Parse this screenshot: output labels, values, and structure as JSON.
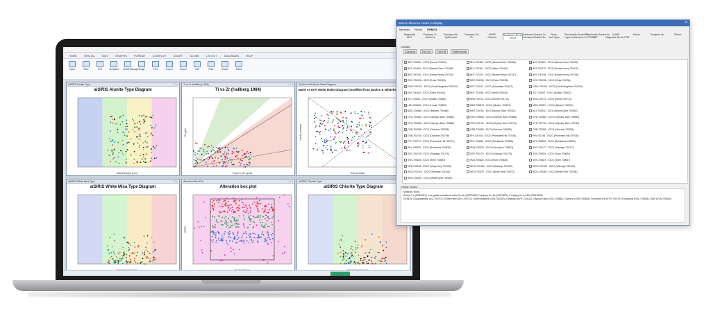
{
  "app": {
    "menu": [
      "HOME",
      "SPATIAL",
      "EDIT",
      "GRAPHS",
      "FORMAT",
      "COMPUTE",
      "CHART",
      "GLOBE",
      "LAYOUT",
      "DIAGRAMS",
      "HELP"
    ],
    "active_menu_index": 8,
    "ribbon_buttons": [
      {
        "label": "Open",
        "icon": "folder-icon"
      },
      {
        "label": "Save",
        "icon": "save-icon"
      },
      {
        "label": "Plot",
        "icon": "plot-icon"
      },
      {
        "label": "Templates",
        "icon": "template-icon"
      },
      {
        "label": "ioGAS Manager",
        "icon": "manager-icon"
      },
      {
        "label": "Image",
        "icon": "image-icon"
      },
      {
        "label": "Print",
        "icon": "print-icon"
      },
      {
        "label": "Export",
        "icon": "export-icon"
      },
      {
        "label": "Report",
        "icon": "report-icon"
      },
      {
        "label": "Edit",
        "icon": "edit-icon"
      },
      {
        "label": "Filter",
        "icon": "filter-icon"
      },
      {
        "label": "Search",
        "icon": "search-icon"
      },
      {
        "label": "Select",
        "icon": "select-icon"
      }
    ],
    "panes": [
      {
        "window_title": "aiSIRIS Alunite Type",
        "chart_title": "aiSIRIS Alunite Type Diagram",
        "xlabel": "Wavelength (nm)",
        "ylabel": ""
      },
      {
        "window_title": "Ti vs Zr (Hallberg 1984)",
        "chart_title": "Ti vs Zr (Hallberg 1984)",
        "xlabel": "Ti ppm (Zr ppm)",
        "ylabel": "Zr ppm"
      },
      {
        "window_title": "Na/Al vs K/Al Molar Ratio Diagram",
        "chart_title": "Na/Al vs K/Al Molar Ratio Diagram (modified from Davies & Whitehead 2006)",
        "xlabel": "K/Al (molar)",
        "ylabel": "Na/Al (molar)"
      },
      {
        "window_title": "aiSIRIS White Mica Type",
        "chart_title": "aiSIRIS White Mica Type Diagram",
        "xlabel": "Wavelength (nm)",
        "ylabel": ""
      },
      {
        "window_title": "Alteration Box Plot",
        "chart_title": "Alteration box plot",
        "xlabel": "AI (Ishikawa)",
        "ylabel": "CCPI"
      },
      {
        "window_title": "aiSIRIS Chlorite Type",
        "chart_title": "aiSIRIS Chlorite Type Diagram",
        "xlabel": "Wavelength (nm)",
        "ylabel": ""
      }
    ]
  },
  "dialog": {
    "title": "Select reference nodes to display",
    "close_glyph": "×",
    "tabs": [
      "Minerals",
      "Rocks",
      "DEMO3"
    ],
    "selected_tab_index": 2,
    "subtabs": [
      {
        "top": "Magnetite",
        "bottom": "BHT"
      },
      {
        "top": "Porphyry Cu",
        "bottom": "Carlin Au"
      },
      {
        "top": "Porphyry Mo",
        "bottom": "Epithermal"
      },
      {
        "top": "Porphyry Sn",
        "bottom": "Fe"
      },
      {
        "top": "SHMS",
        "bottom": "Greisen"
      },
      {
        "top": "Sandstone Pb-Zn",
        "bottom": "IOCG"
      },
      {
        "top": "Sediment Hosted Cu",
        "bottom": "Intrusion Related Au"
      },
      {
        "top": "Skarn",
        "bottom": "Irish Type"
      },
      {
        "top": "Structurally Hosted Cu",
        "bottom": "Layered Intrusion Cr-PGE-V"
      },
      {
        "top": "Structurally Hosted Au",
        "bottom": "MVT"
      },
      {
        "top": "VHMS",
        "bottom": "Magmatic Ni-Cu-PGE"
      },
      {
        "top": "",
        "bottom": "Mantu"
      },
      {
        "top": "",
        "bottom": "Orogenic Au"
      },
      {
        "top": "",
        "bottom": "Others"
      }
    ],
    "selected_subtab_index": 5,
    "visibility_label": "Visibility",
    "buttons": [
      "Clear All",
      "Tick On",
      "Tick Off",
      "References"
    ],
    "checkbox_items": [
      "AMT-701000 - IOCG (Ernest 701000)",
      "BLS-700456 - IOCG (Barnett Seco 700456)",
      "BLS-700461 - IOCG (Barnett Seco 700461)",
      "BLS-700459 - IOCG (Barnett Seco 700459)",
      "BLS-700467 - IOCG (Esker 700467)",
      "BLS-700470 - IOCG (Ernest Henry 700470)",
      "BHT-700746 - IOCG (Ernest Henry 700746)",
      "BHT-700747 - IOCG (Ernest Henry 700747)",
      "BHT-700748 - IOCG (Ernest Henry 700748)",
      "DEO-700228 - IOCG (Eeka 700228)",
      "DEO-700235 - IOCG (Eeka 700235)",
      "DEO-700236 - IOCG (Eeka 700236)",
      "GWH-700202 - IOCG (Guelb Moghrein 700202)",
      "KRT-701612 - IOCG (Kamantan 701612)",
      "GWH-700203 - IOCG (Guelb Moghrein 700203)",
      "KHT-700444 - IOCG (Kheti 700444)",
      "KHT-700445 - IOCG (Kheti 700445)",
      "KLT-700822 - IOCG (Kuillan 700822)",
      "KLT-700823 - IOCG (Kuillan 700823)",
      "KRA-700712 - IOCG (Kurilla 700712)",
      "KRA-700713 - IOCG (Kurilla 700713)",
      "LNN-700640 - IOCG (Lonnie 700640)",
      "MDS-700870 - IOCG (Meaner 700870)",
      "MDS-700871 - IOCG (Meaner 700871)",
      "MDS-700868 - IOCG (Meaner 700868)",
      "MNT-700762 - IOCG (Mount Elliott 700762)",
      "MLT-700932 - IOCG (Mount Elliott 700932)",
      "OYD-700582 - IOCG (Olympic Dam 700582)",
      "OYD-700583 - IOCG (Olympic Dam 700583)",
      "OYD-700584 - IOCG (Olympic Dam 700584)",
      "OYD-700585 - IOCG (Olympic Dam 700585)",
      "OYD-700741 - IOCG (Olympic Dam 700741)",
      "OYD-700742 - IOCG (Olympic Dam 700742)",
      "OSB-700585 - IOCG (Osborne 700585)",
      "OSB-700580 - IOCG (Osborne 700580)",
      "OSB-700581 - IOCG (Osborne 700581)",
      "OSB-700749 - IOCG (Osborne 700749)",
      "PHI-700745 - IOCG (Prominent Hill 700745)",
      "PHI-700746 - IOCG (Prominent Hill 700746)",
      "PTH-700747 - IOCG (Prominent Hill 700747)",
      "RKL-700828 - IOCG (Rocklands 700828)",
      "RKL-700829 - IOCG (Rocklands 700829)",
      "RKL-700830 - IOCG (Rocklands 700830)",
      "SNQ-700523 - IOCG (San Quon 700523)",
      "SSG-700177 - IOCG (Sossego 700177)",
      "SSG-700178 - IOCG (Sossego 700178)",
      "SSG-700179 - IOCG (Sossego 700179)",
      "SVN-700624 - IOCG (Sven 700624)",
      "SVN-700625 - IOCG (Sven 700625)",
      "SVN-700626 - IOCG (Sven 700626)",
      "SVN-700627 - IOCG (Sven 700627)",
      "VRE-700138 - IOCG (Vergenoeg 700138)",
      "WGO-700102 - IOCG (Warrego 700102)",
      "WGO-700103 - IOCG (Warrego 700103)",
      "WGO-700104 - IOCG (Warrego 700104)",
      "WDV-700237 - IOCG (White Devil 700237)",
      "WDV-700238 - IOCG (White Devil 700238)",
      "WDV-700239 - IOCG (White Devil 700239)"
    ],
    "checked_indices": [
      4,
      7,
      10,
      13,
      16,
      19,
      22,
      25,
      28,
      31,
      34,
      37,
      40,
      43
    ],
    "visible_nodes_label": "Visible Nodes",
    "visible_nodes": [
      "Minerals: None.",
      "Rocks: Cu (ORE4610), Low grade transitional oxide Cu-Au (ORE4630), Porphyry Cu-Au (ORE4632), Porphyry Cu-Au-Mo (ORE4633).",
      "DEMO3: Chuquicamata (CQ-700747), Ernest Henry (EH-700747), Guelb Moghrein (GM-700202), Kamantan (KRT-701612), Olympic Dam (OYD-700582), Osborne (OSB-700585), Prominent Hill (PTH-700747), Rocklands (RKL-700828), Sven (SVN-700626)."
    ]
  }
}
